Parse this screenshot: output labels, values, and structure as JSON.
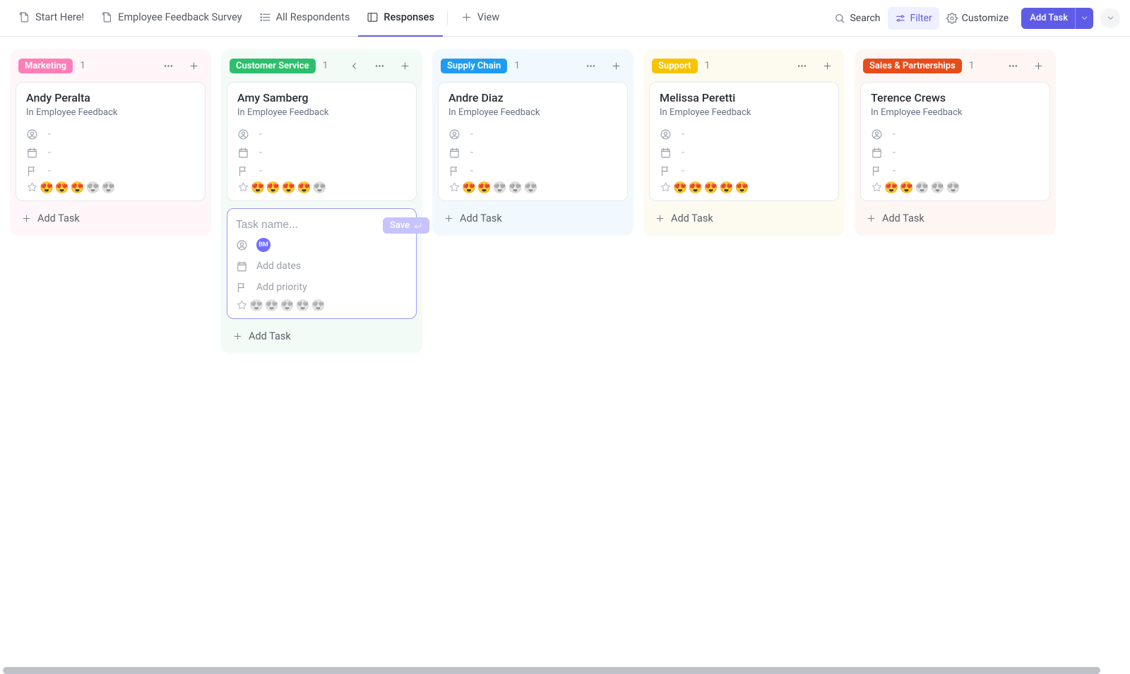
{
  "topbar": {
    "tabs": [
      {
        "label": "Start Here!"
      },
      {
        "label": "Employee Feedback Survey"
      },
      {
        "label": "All Respondents"
      },
      {
        "label": "Responses"
      },
      {
        "label": "View"
      }
    ],
    "tools": {
      "search": "Search",
      "filter": "Filter",
      "customize": "Customize",
      "add_task": "Add Task"
    }
  },
  "columns": [
    {
      "id": "marketing",
      "label": "Marketing",
      "count": "1",
      "pill_bg": "#ff7eb6",
      "col_bg": "#fef6f8",
      "cards": [
        {
          "title": "Andy Peralta",
          "sub": "In Employee Feedback",
          "rating": 3
        }
      ]
    },
    {
      "id": "customer-service",
      "label": "Customer Service",
      "count": "1",
      "pill_bg": "#2dbf6d",
      "col_bg": "#f3fbf6",
      "show_collapse": true,
      "cards": [
        {
          "title": "Amy Samberg",
          "sub": "In Employee Feedback",
          "rating": 4
        }
      ],
      "new_task": {
        "placeholder": "Task name...",
        "save": "Save",
        "avatar": "BM",
        "add_dates": "Add dates",
        "add_priority": "Add priority"
      }
    },
    {
      "id": "supply-chain",
      "label": "Supply Chain",
      "count": "1",
      "pill_bg": "#1f9cf0",
      "col_bg": "#f2f9fe",
      "cards": [
        {
          "title": "Andre Diaz",
          "sub": "In Employee Feedback",
          "rating": 2
        }
      ]
    },
    {
      "id": "support",
      "label": "Support",
      "count": "1",
      "pill_bg": "#f7c300",
      "col_bg": "#fdfaf0",
      "cards": [
        {
          "title": "Melissa Peretti",
          "sub": "In Employee Feedback",
          "rating": 5
        }
      ]
    },
    {
      "id": "sales",
      "label": "Sales & Partnerships",
      "count": "1",
      "pill_bg": "#e84c1a",
      "col_bg": "#fef6f3",
      "cards": [
        {
          "title": "Terence Crews",
          "sub": "In Employee Feedback",
          "rating": 2
        }
      ]
    }
  ],
  "strings": {
    "add_task": "Add Task",
    "dash": "-"
  }
}
